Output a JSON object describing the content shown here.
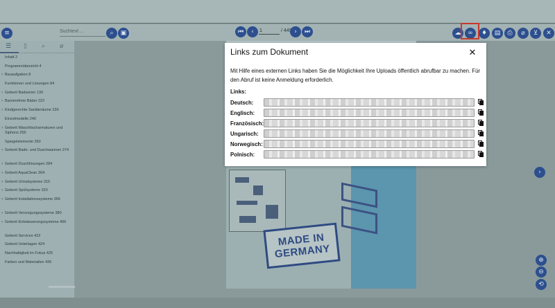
{
  "toolbar": {
    "search_placeholder": "Suchtext ...",
    "page_value": "1",
    "page_total": "/ 449"
  },
  "sidebar": {
    "toc": [
      {
        "label": "Inhalt 2",
        "expandable": false
      },
      {
        "label": "Programmübersicht 4",
        "expandable": false
      },
      {
        "label": "Bauaufgaben 8",
        "expandable": true
      },
      {
        "label": "Funktionen und Lösungen 84",
        "expandable": false
      },
      {
        "label": "Geberit Badserien 130",
        "expandable": true
      },
      {
        "label": "Barrierefreie Bäder 222",
        "expandable": true
      },
      {
        "label": "Kindgerechte Sanitärräume 230",
        "expandable": true
      },
      {
        "label": "Einzelmodelle 240",
        "expandable": false
      },
      {
        "label": "Geberit Waschtischarmaturen und Siphons 255",
        "expandable": true
      },
      {
        "label": "Spiegelelemente 260",
        "expandable": false
      },
      {
        "label": "Geberit Bade- und Duschwannen 274",
        "expandable": true
      },
      {
        "label": "Geberit Duschlösungen 284",
        "expandable": true
      },
      {
        "label": "Geberit AquaClean 304",
        "expandable": true
      },
      {
        "label": "Geberit Urinalsysteme 315",
        "expandable": true
      },
      {
        "label": "Geberit Spülsysteme 320",
        "expandable": true
      },
      {
        "label": "Geberit Installationssysteme 356",
        "expandable": true
      },
      {
        "label": "Geberit Versorgungssysteme 380",
        "expandable": true
      },
      {
        "label": "Geberit Entwässerungssysteme 406",
        "expandable": true
      },
      {
        "label": "Geberit Services 422",
        "expandable": false
      },
      {
        "label": "Geberit Unterlagen 424",
        "expandable": false
      },
      {
        "label": "Nachhaltigkeit im Fokus 425",
        "expandable": false
      },
      {
        "label": "Farben und Materialien 436",
        "expandable": false
      }
    ]
  },
  "page_art": {
    "stamp_line1": "MADE IN",
    "stamp_line2": "GERMANY"
  },
  "modal": {
    "title": "Links zum Dokument",
    "close": "✕",
    "description": "Mit Hilfe eines externen Links haben Sie die Möglichkeit Ihre Uploads öffentlich abrufbar zu machen. Für den Abruf ist keine Anmeldung erforderlich.",
    "links_heading": "Links:",
    "links": [
      {
        "label": "Deutsch:"
      },
      {
        "label": "Englisch:"
      },
      {
        "label": "Französisch:"
      },
      {
        "label": "Ungarisch:"
      },
      {
        "label": "Norwegisch:"
      },
      {
        "label": "Polnisch:"
      }
    ]
  },
  "colors": {
    "accent": "#2d4f8e",
    "highlight": "#c8372c",
    "overlay": "#8a9a9b"
  }
}
